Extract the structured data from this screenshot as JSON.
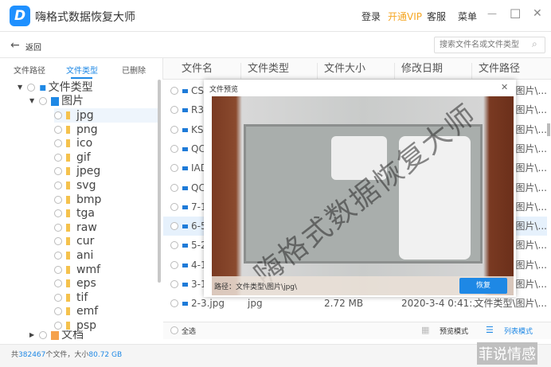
{
  "app": {
    "title": "嗨格式数据恢复大师",
    "logo": "D"
  },
  "titlebar": {
    "login": "登录",
    "vip": "开通VIP",
    "service": "客服",
    "menu": "菜单",
    "minimize": "—",
    "maximize": "☐",
    "close": "✕"
  },
  "toolbar": {
    "back": "返回",
    "search_placeholder": "搜索文件名或文件类型"
  },
  "tabs": [
    "文件路径",
    "文件类型",
    "已删除"
  ],
  "columns": [
    "文件名",
    "文件类型",
    "文件大小",
    "修改日期",
    "文件路径"
  ],
  "tree": {
    "root": "文件类型",
    "images": "图片",
    "exts": [
      "jpg",
      "png",
      "ico",
      "gif",
      "jpeg",
      "svg",
      "bmp",
      "tga",
      "raw",
      "cur",
      "ani",
      "wmf",
      "eps",
      "tif",
      "emf",
      "psp"
    ],
    "docs": "文档"
  },
  "rows": [
    {
      "name": "CS",
      "path": "\\图片\\..."
    },
    {
      "name": "R3",
      "path": "\\图片\\..."
    },
    {
      "name": "KS",
      "path": "\\图片\\..."
    },
    {
      "name": "QC",
      "path": "\\图片\\..."
    },
    {
      "name": "IAD",
      "path": "\\图片\\..."
    },
    {
      "name": "QC",
      "path": "\\图片\\..."
    },
    {
      "name": "7-1",
      "path": "\\图片\\..."
    },
    {
      "name": "6-5",
      "path": "\\图片\\..."
    },
    {
      "name": "5-2",
      "path": "\\图片\\..."
    },
    {
      "name": "4-1",
      "path": "\\图片\\..."
    },
    {
      "name": "3-1",
      "path": "\\图片\\..."
    },
    {
      "name": "2-3.jpg",
      "type": "jpg",
      "size": "2.72 MB",
      "date": "2020-3-4 0:41:...",
      "path": "文件类型\\图片\\..."
    }
  ],
  "modal": {
    "title": "文件预览",
    "close": "✕",
    "path": "路径：文件类型\\图片\\jpg\\",
    "restore": "恢复",
    "watermark": "嗨格式数据恢复大师"
  },
  "bottom": {
    "select_all": "全选",
    "preview_mode": "预览模式",
    "list_mode": "列表模式"
  },
  "status": {
    "prefix": "共",
    "count": "382467",
    "mid": "个文件，大小",
    "size": "80.72 GB"
  },
  "overlay_text": "菲说情感",
  "colors": {
    "accent": "#1e88e5",
    "vip": "#f5a623"
  }
}
